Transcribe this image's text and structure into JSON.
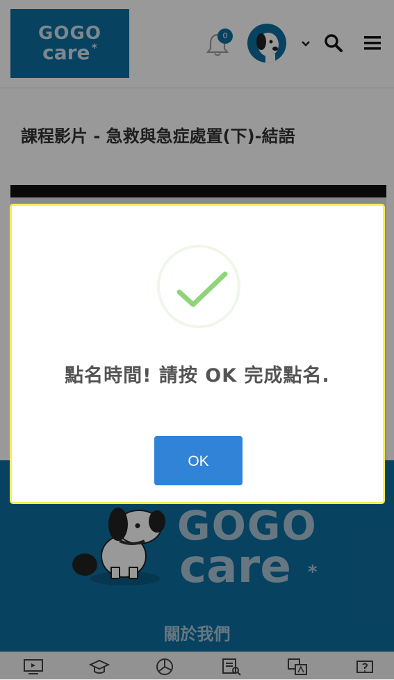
{
  "header": {
    "logo_line1": "GOGO",
    "logo_line2": "care",
    "logo_star": "*",
    "notification_count": "0"
  },
  "page_title": "課程影片 - 急救與急症處置(下)-結語",
  "footer": {
    "logo_line1": "GOGO",
    "logo_line2": "care",
    "logo_star": "*",
    "about_label": "關於我們"
  },
  "bottom_nav": [
    {
      "icon": "tv-icon"
    },
    {
      "icon": "graduation-cap-icon"
    },
    {
      "icon": "pie-chart-icon"
    },
    {
      "icon": "report-search-icon"
    },
    {
      "icon": "translate-icon"
    },
    {
      "icon": "help-ticket-icon"
    }
  ],
  "modal": {
    "message": "點名時間! 請按 OK 完成點名.",
    "ok_label": "OK",
    "icon": "success-check-icon"
  },
  "colors": {
    "brand": "#0d6ea0",
    "ok_button": "#3083d6",
    "check": "#8fd479",
    "modal_border": "#f7ee55"
  }
}
